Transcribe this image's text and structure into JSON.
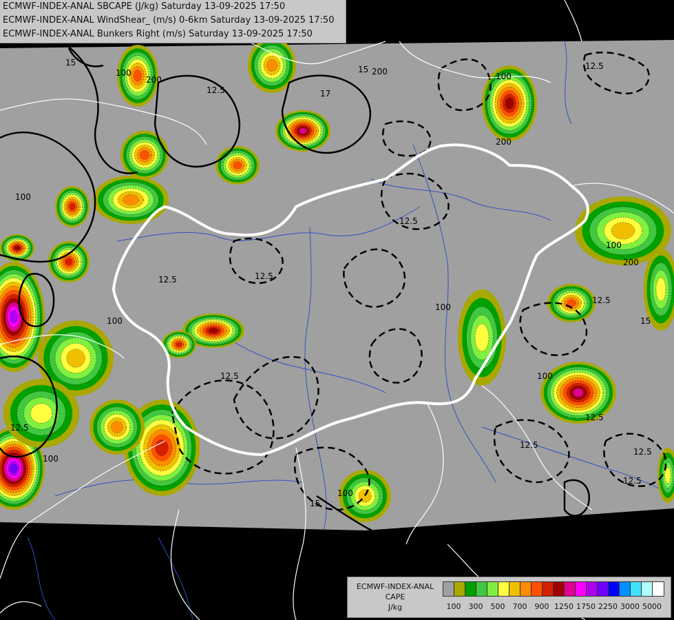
{
  "header": {
    "lines": [
      "ECMWF-INDEX-ANAL SBCAPE (J/kg) Saturday 13-09-2025 17:50",
      "ECMWF-INDEX-ANAL WindShear_ (m/s) 0-6km Saturday 13-09-2025 17:50",
      "ECMWF-INDEX-ANAL Bunkers Right (m/s) Saturday 13-09-2025 17:50"
    ]
  },
  "legend": {
    "title_lines": [
      "ECMWF-INDEX-ANAL",
      "CAPE",
      "J/kg"
    ],
    "colors": [
      "#a0a0a0",
      "#a8a800",
      "#00a000",
      "#40c840",
      "#80f040",
      "#ffff40",
      "#f0c000",
      "#ff8c00",
      "#ff5000",
      "#d42000",
      "#a00000",
      "#e00090",
      "#ff00ff",
      "#b000f0",
      "#7000ff",
      "#0000ff",
      "#0090ff",
      "#40e0ff",
      "#b0ffff",
      "#ffffff"
    ],
    "tick_labels": [
      "100",
      "300",
      "500",
      "700",
      "900",
      "1250",
      "1750",
      "2250",
      "3000",
      "5000"
    ]
  },
  "map": {
    "contour_labels": [
      "15",
      "100",
      "200",
      "12.5",
      "17",
      "15",
      "100",
      "200",
      "12.5",
      "12.5",
      "12.5",
      "12.5",
      "12.5",
      "100",
      "200",
      "12.5",
      "15",
      "100",
      "12.5",
      "100",
      "100",
      "100",
      "100",
      "12.5",
      "15",
      "200",
      "100",
      "12.5",
      "12.5",
      "12.5"
    ],
    "colors": {
      "domain": "#a0a0a0",
      "outside": "#000000",
      "border": "#ffffff",
      "rivers": "#3050c0",
      "contour": "#000000"
    }
  }
}
